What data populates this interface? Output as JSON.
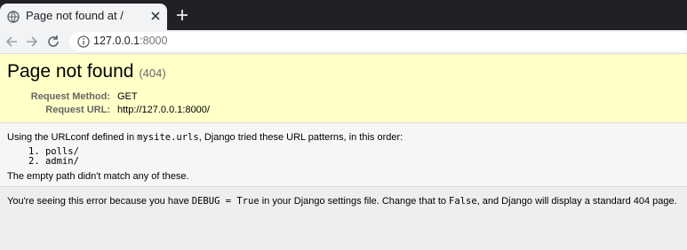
{
  "browser": {
    "tab_title": "Page not found at /",
    "url_host": "127.0.0.1",
    "url_port": ":8000",
    "icons": {
      "favicon": "globe-icon",
      "close": "close-icon",
      "new_tab": "plus-icon",
      "back": "arrow-left-icon",
      "forward": "arrow-right-icon",
      "reload": "reload-icon",
      "info": "info-icon"
    }
  },
  "summary": {
    "title": "Page not found",
    "status_code": "(404)",
    "request_method_label": "Request Method:",
    "request_method": "GET",
    "request_url_label": "Request URL:",
    "request_url": "http://127.0.0.1:8000/"
  },
  "info": {
    "prefix": "Using the URLconf defined in ",
    "urlconf": "mysite.urls",
    "suffix": ", Django tried these URL patterns, in this order:",
    "patterns": [
      "1.  polls/",
      "2.  admin/"
    ],
    "no_match": "The empty path didn't match any of these."
  },
  "explanation": {
    "part1": "You're seeing this error because you have ",
    "debug_code": "DEBUG = True",
    "part2": " in your Django settings file. Change that to ",
    "false_code": "False",
    "part3": ", and Django will display a standard 404 page."
  },
  "colors": {
    "summary_bg": "#ffffc8",
    "tabbar_bg": "#202124",
    "toolbar_bg": "#f1f3f4"
  }
}
